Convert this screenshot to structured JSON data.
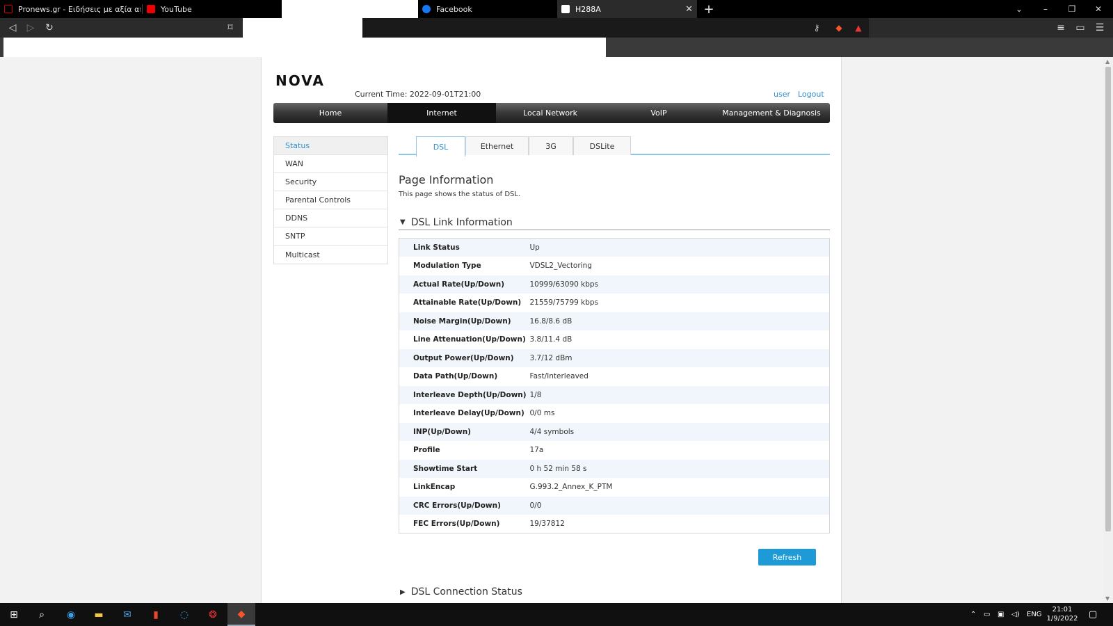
{
  "browser": {
    "tabs": [
      {
        "title": "Pronews.gr - Ειδήσεις με αξία από τη",
        "icon": "pronews-icon"
      },
      {
        "title": "YouTube",
        "icon": "youtube-icon"
      },
      {
        "title": "",
        "icon": ""
      },
      {
        "title": "Facebook",
        "icon": "facebook-icon"
      },
      {
        "title": "H288A",
        "icon": "router-page-icon"
      }
    ],
    "close_glyph": "✕",
    "new_tab_glyph": "+"
  },
  "header": {
    "logo": "NOVA",
    "current_time": "Current Time: 2022-09-01T21:00",
    "user_link": "user",
    "logout_link": "Logout"
  },
  "nav": {
    "items": [
      "Home",
      "Internet",
      "Local Network",
      "VoIP",
      "Management & Diagnosis"
    ],
    "active": "Internet"
  },
  "side_menu": {
    "items": [
      "Status",
      "WAN",
      "Security",
      "Parental Controls",
      "DDNS",
      "SNTP",
      "Multicast"
    ],
    "active": "Status"
  },
  "sub_tabs": {
    "items": [
      "DSL",
      "Ethernet",
      "3G",
      "DSLite"
    ],
    "active": "DSL"
  },
  "page_info": {
    "title": "Page Information",
    "description": "This page shows the status of DSL."
  },
  "dsl_section": {
    "title": "DSL Link Information",
    "rows": [
      {
        "label": "Link Status",
        "value": "Up"
      },
      {
        "label": "Modulation Type",
        "value": "VDSL2_Vectoring"
      },
      {
        "label": "Actual Rate(Up/Down)",
        "value": "10999/63090 kbps"
      },
      {
        "label": "Attainable Rate(Up/Down)",
        "value": "21559/75799 kbps"
      },
      {
        "label": "Noise Margin(Up/Down)",
        "value": "16.8/8.6 dB"
      },
      {
        "label": "Line Attenuation(Up/Down)",
        "value": "3.8/11.4 dB"
      },
      {
        "label": "Output Power(Up/Down)",
        "value": "3.7/12 dBm"
      },
      {
        "label": "Data Path(Up/Down)",
        "value": "Fast/Interleaved"
      },
      {
        "label": "Interleave Depth(Up/Down)",
        "value": "1/8"
      },
      {
        "label": "Interleave Delay(Up/Down)",
        "value": "0/0 ms"
      },
      {
        "label": "INP(Up/Down)",
        "value": "4/4 symbols"
      },
      {
        "label": "Profile",
        "value": "17a"
      },
      {
        "label": "Showtime Start",
        "value": "0 h 52 min 58 s"
      },
      {
        "label": "LinkEncap",
        "value": "G.993.2_Annex_K_PTM"
      },
      {
        "label": "CRC Errors(Up/Down)",
        "value": "0/0"
      },
      {
        "label": "FEC Errors(Up/Down)",
        "value": "19/37812"
      }
    ]
  },
  "refresh_button": "Refresh",
  "connection_section": {
    "title": "DSL Connection Status"
  },
  "taskbar": {
    "language": "ENG",
    "time": "21:01",
    "date": "1/9/2022"
  },
  "colors": {
    "accent": "#1e9ad6",
    "link": "#2a8fd0"
  }
}
